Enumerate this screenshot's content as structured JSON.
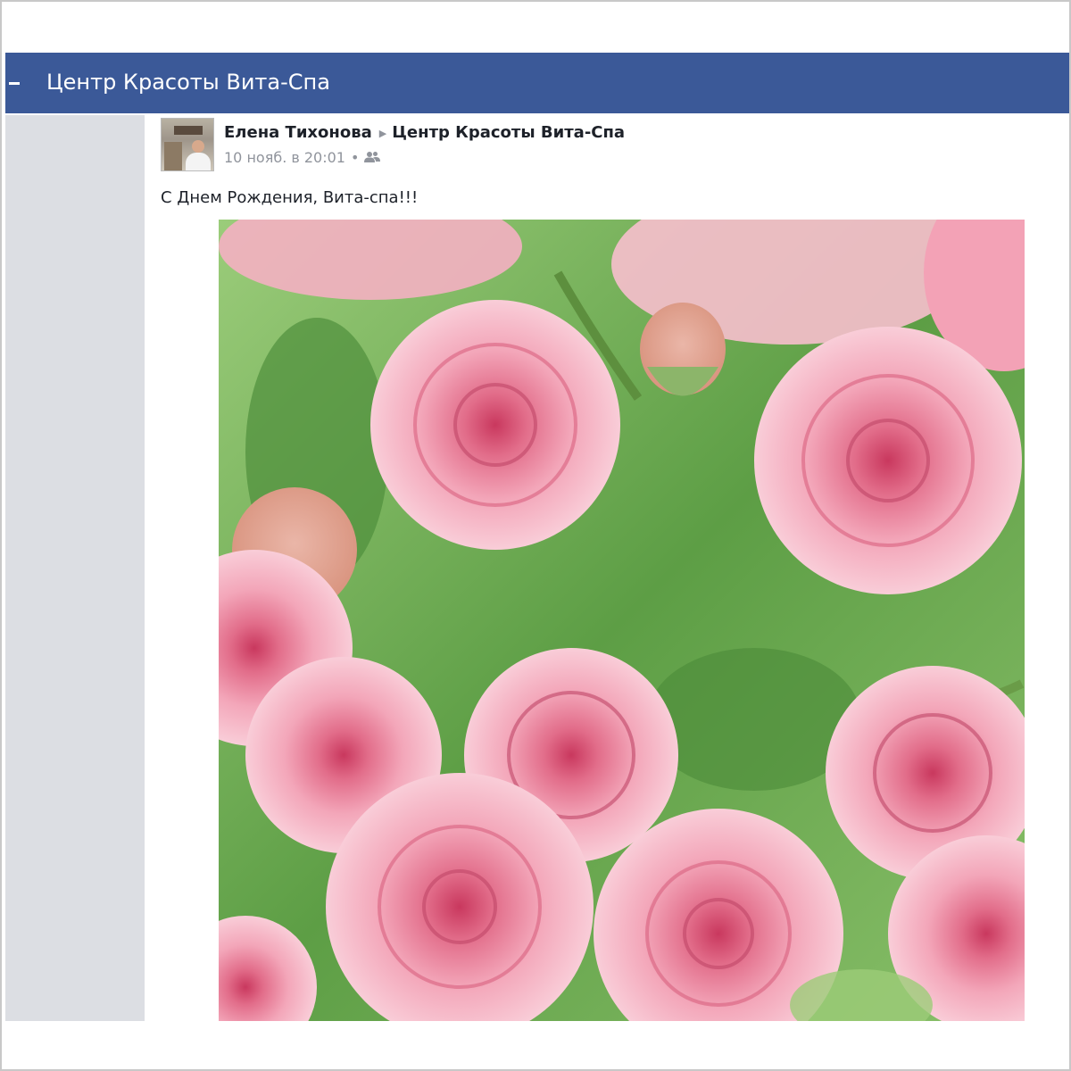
{
  "header": {
    "title": "Центр Красоты Вита-Спа"
  },
  "post": {
    "author": "Елена Тихонова",
    "target": "Центр Красоты Вита-Спа",
    "timestamp": "10 нояб. в 20:01",
    "privacy_icon": "friends-icon",
    "message": "С Днем Рождения, Вита-спа!!!",
    "photo": {
      "subject": "pink-roses-icon"
    }
  },
  "colors": {
    "header_bg": "#3b5998",
    "sidebar_bg": "#dcdee3",
    "rose_pink": "#f2a0b4",
    "leaf_green": "#5fa048"
  }
}
